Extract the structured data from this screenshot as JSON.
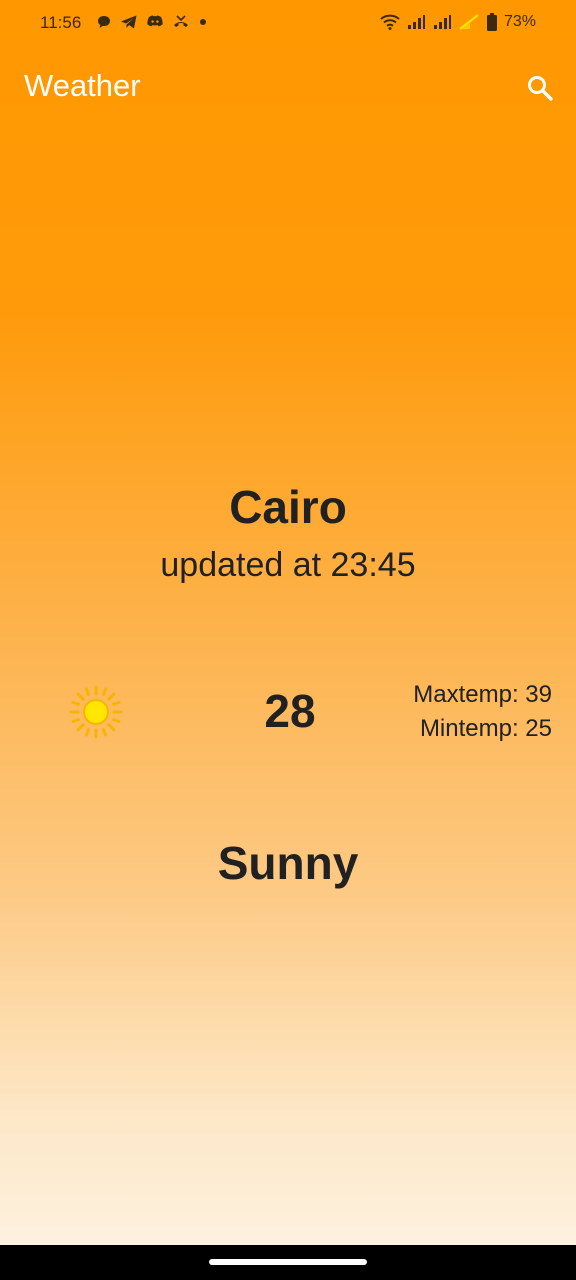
{
  "status_bar": {
    "time": "11:56",
    "battery_percent": "73%",
    "left_icons": [
      "chat-bubble-icon",
      "telegram-icon",
      "discord-icon",
      "missed-call-icon",
      "dot-icon"
    ],
    "right_icons": [
      "wifi-icon",
      "signal-icon",
      "signal-icon",
      "no-sim-icon",
      "battery-icon"
    ]
  },
  "app_bar": {
    "title": "Weather",
    "search_icon": "search-icon",
    "color": "#ff9800"
  },
  "weather": {
    "city": "Cairo",
    "updated": "updated at 23:45",
    "icon": "sun-icon",
    "temperature": "28",
    "max_temp": "Maxtemp: 39",
    "min_temp": "Mintemp: 25",
    "condition": "Sunny"
  }
}
